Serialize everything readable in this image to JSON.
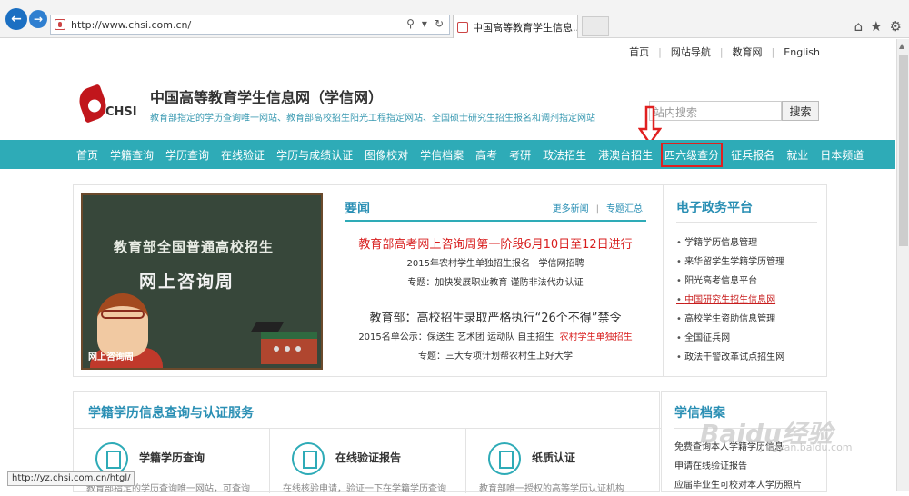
{
  "browser": {
    "url": "http://www.chsi.com.cn/",
    "tab_title": "中国高等教育学生信息...",
    "tab_close": "×"
  },
  "top_links": [
    "首页",
    "网站导航",
    "教育网",
    "English"
  ],
  "header": {
    "logo_text": "CHSI",
    "title": "中国高等教育学生信息网（学信网）",
    "subtitle": "教育部指定的学历查询唯一网站、教育部高校招生阳光工程指定网站、全国硕士研究生招生报名和调剂指定网站",
    "search_placeholder": "站内搜索",
    "search_button": "搜索"
  },
  "main_nav": [
    "首页",
    "学籍查询",
    "学历查询",
    "在线验证",
    "学历与成绩认证",
    "图像校对",
    "学信档案",
    "高考",
    "考研",
    "政法招生",
    "港澳台招生",
    "四六级查分",
    "征兵报名",
    "就业",
    "日本频道"
  ],
  "hero": {
    "line1": "教育部全国普通高校招生",
    "line2": "网上咨询周",
    "caption": "网上咨询周"
  },
  "news": {
    "title": "要闻",
    "more": "更多新闻",
    "topics": "专题汇总",
    "headline1": "教育部高考网上咨询周第一阶段6月10日至12日进行",
    "sub1a": "2015年农村学生单独招生报名",
    "sub1b": "学信网招聘",
    "sub1c": "专题：加快发展职业教育  谨防非法代办认证",
    "headline2": "教育部：高校招生录取严格执行“26个不得”禁令",
    "sub2a": "2015名单公示：保送生 艺术团 运动队 自主招生",
    "sub2b": "农村学生单独招生",
    "sub2c": "专题：三大专项计划帮农村生上好大学"
  },
  "gov": {
    "title": "电子政务平台",
    "items": [
      "学籍学历信息管理",
      "来华留学生学籍学历管理",
      "阳光高考信息平台",
      "中国研究生招生信息网",
      "高校学生资助信息管理",
      "全国征兵网",
      "政法干警改革试点招生网"
    ]
  },
  "services": {
    "title": "学籍学历信息查询与认证服务",
    "items": [
      {
        "name": "学籍学历查询",
        "desc": "教育部指定的学历查询唯一网站，可查询"
      },
      {
        "name": "在线验证报告",
        "desc": "在线核验申请，验证一下在学籍学历查询"
      },
      {
        "name": "纸质认证",
        "desc": "教育部唯一授权的高等学历认证机构"
      }
    ]
  },
  "archive": {
    "title": "学信档案",
    "items": [
      "免费查询本人学籍学历信息",
      "申请在线验证报告",
      "应届毕业生可校对本人学历照片"
    ]
  },
  "status_url": "http://yz.chsi.com.cn/htgl/",
  "watermark": "Baidu经验",
  "watermark_sub": "jingyan.baidu.com"
}
